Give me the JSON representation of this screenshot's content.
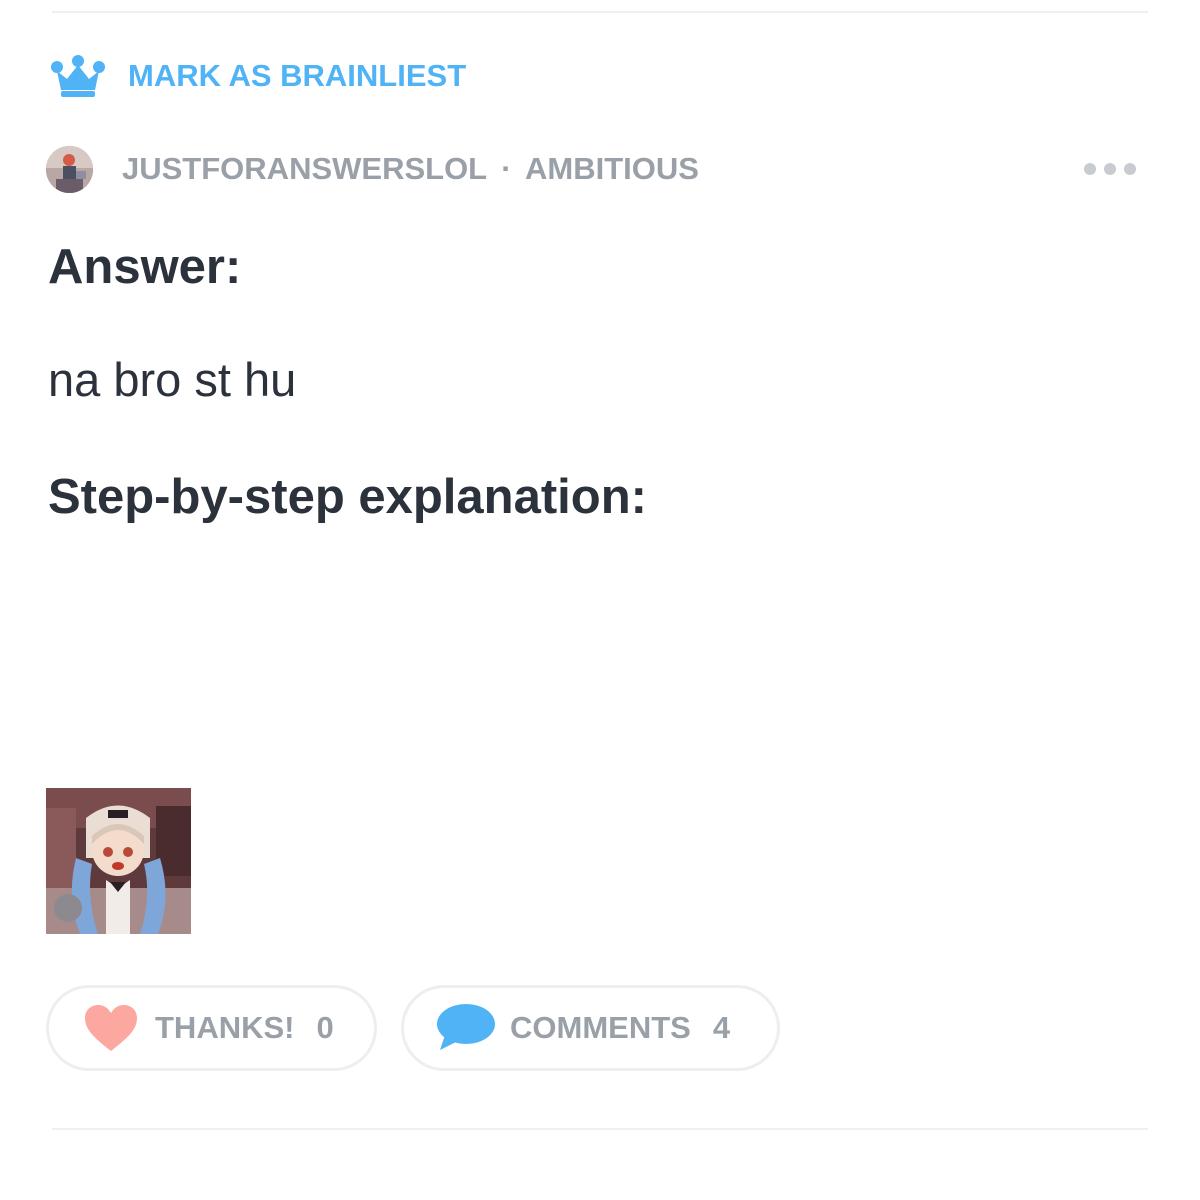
{
  "actions": {
    "brainliest_label": "MARK AS BRAINLIEST",
    "brainliest_icon": "crown-icon"
  },
  "author": {
    "username": "JUSTFORANSWERSLOL",
    "separator": "·",
    "rank": "AMBITIOUS",
    "more_icon": "more-dots-icon"
  },
  "answer": {
    "heading": "Answer:",
    "text": "na bro st hu",
    "explanation_heading": "Step-by-step explanation:"
  },
  "footer": {
    "thanks_label": "THANKS!",
    "thanks_count": "0",
    "comments_label": "COMMENTS",
    "comments_count": "4"
  },
  "colors": {
    "accent": "#4fb3f6",
    "muted_text": "#9aa0a8",
    "heading_text": "#2b323b",
    "heart": "#fca8a0",
    "border": "#eceef1"
  }
}
